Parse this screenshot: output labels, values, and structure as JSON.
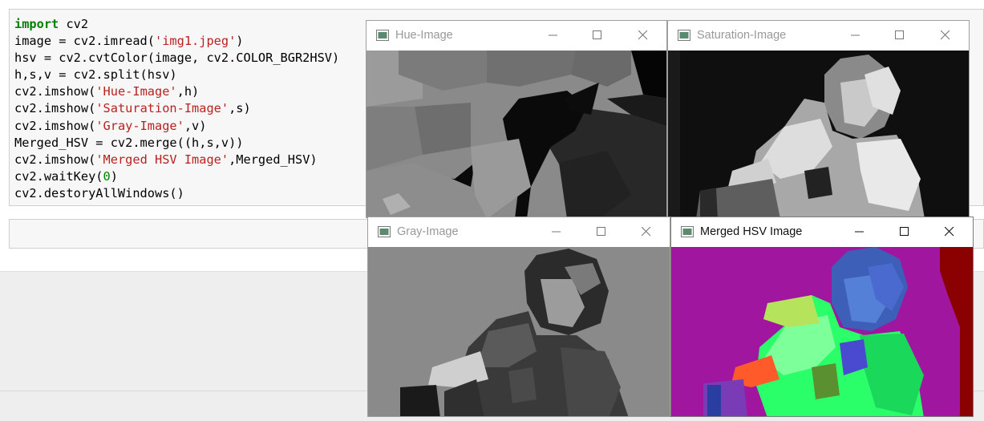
{
  "code_lines": [
    [
      {
        "t": "import",
        "c": "kw"
      },
      {
        "t": " cv2"
      }
    ],
    [
      {
        "t": "image = cv2.imread("
      },
      {
        "t": "'img1.jpeg'",
        "c": "str"
      },
      {
        "t": ")"
      }
    ],
    [
      {
        "t": "hsv = cv2.cvtColor(image, cv2.COLOR_BGR2HSV)"
      }
    ],
    [
      {
        "t": "h,s,v = cv2.split(hsv)"
      }
    ],
    [
      {
        "t": "cv2.imshow("
      },
      {
        "t": "'Hue-Image'",
        "c": "str"
      },
      {
        "t": ",h)"
      }
    ],
    [
      {
        "t": "cv2.imshow("
      },
      {
        "t": "'Saturation-Image'",
        "c": "str"
      },
      {
        "t": ",s)"
      }
    ],
    [
      {
        "t": "cv2.imshow("
      },
      {
        "t": "'Gray-Image'",
        "c": "str"
      },
      {
        "t": ",v)"
      }
    ],
    [
      {
        "t": "Merged_HSV = cv2.merge((h,s,v))"
      }
    ],
    [
      {
        "t": "cv2.imshow("
      },
      {
        "t": "'Merged HSV Image'",
        "c": "str"
      },
      {
        "t": ",Merged_HSV)"
      }
    ],
    [
      {
        "t": "cv2.waitKey("
      },
      {
        "t": "0",
        "c": "num"
      },
      {
        "t": ")"
      }
    ],
    [
      {
        "t": "cv2.destoryAllWindows()"
      }
    ]
  ],
  "windows": {
    "hue": {
      "title": "Hue-Image"
    },
    "saturation": {
      "title": "Saturation-Image"
    },
    "gray": {
      "title": "Gray-Image"
    },
    "merged": {
      "title": "Merged HSV Image"
    }
  },
  "colors": {
    "keyword": "#008000",
    "string": "#ba2121",
    "number": "#008000",
    "active_title": "#111111",
    "inactive_title": "#999999",
    "hsv_background": "#a0169f",
    "hsv_edge": "#8b0000"
  },
  "icons": [
    "window-app-icon",
    "minimize-icon",
    "maximize-icon",
    "close-icon"
  ]
}
